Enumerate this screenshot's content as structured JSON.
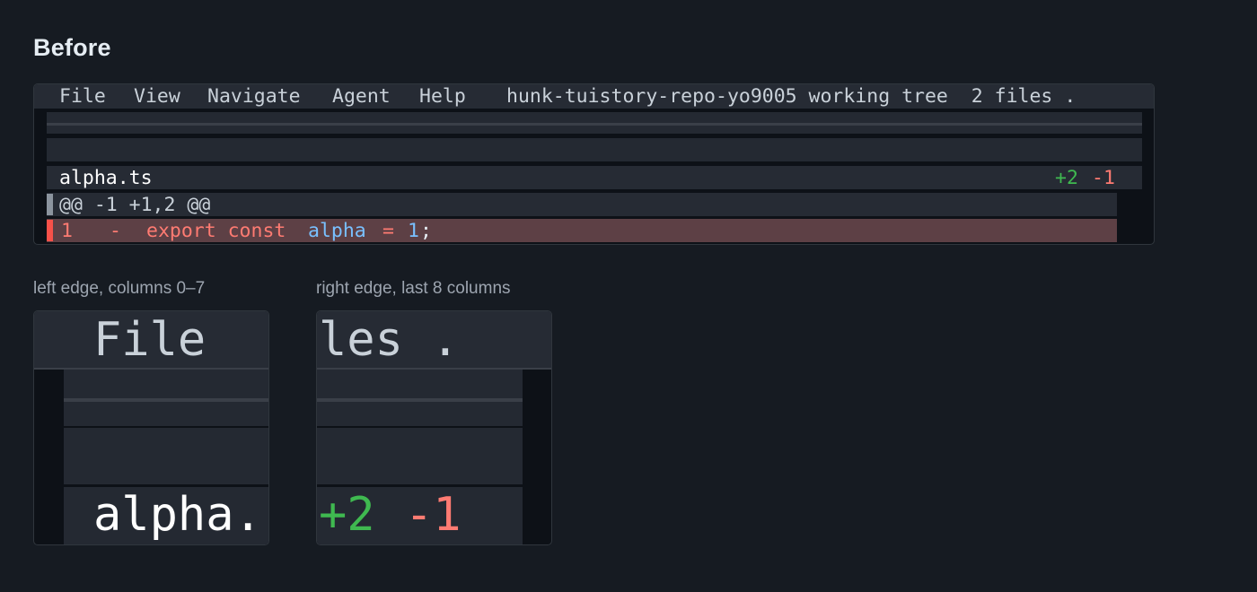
{
  "heading": "Before",
  "terminal": {
    "menu": {
      "file": "File",
      "view": "View",
      "navigate": "Navigate",
      "agent": "Agent",
      "help": "Help",
      "status": "hunk-tuistory-repo-yo9005 working tree  2 files ."
    },
    "file_row": {
      "filename": "alpha.ts",
      "additions": "+2",
      "deletions": "-1"
    },
    "hunk_header": "@@ -1 +1,2 @@",
    "deleted_line": {
      "line_number": "1",
      "sign": "-",
      "keywords": "export const",
      "identifier": "alpha",
      "operator": "=",
      "number": "1",
      "terminator": ";"
    }
  },
  "zoom_left": {
    "caption": "left edge, columns 0–7",
    "top_text": "File",
    "bottom_text": "alpha."
  },
  "zoom_right": {
    "caption": "right edge, last 8 columns",
    "top_text": "les .",
    "additions": "+2",
    "deletions": "-1"
  },
  "colors": {
    "background": "#161b22",
    "terminal_bg": "#0d1117",
    "bar_bg": "#262b34",
    "deleted_line_bg": "#5d4045",
    "addition_green": "#3fb950",
    "deletion_red": "#ff7b72",
    "identifier_blue": "#79c0ff",
    "hunk_marker_gray": "#8b949e",
    "deletion_marker": "#f85149"
  }
}
